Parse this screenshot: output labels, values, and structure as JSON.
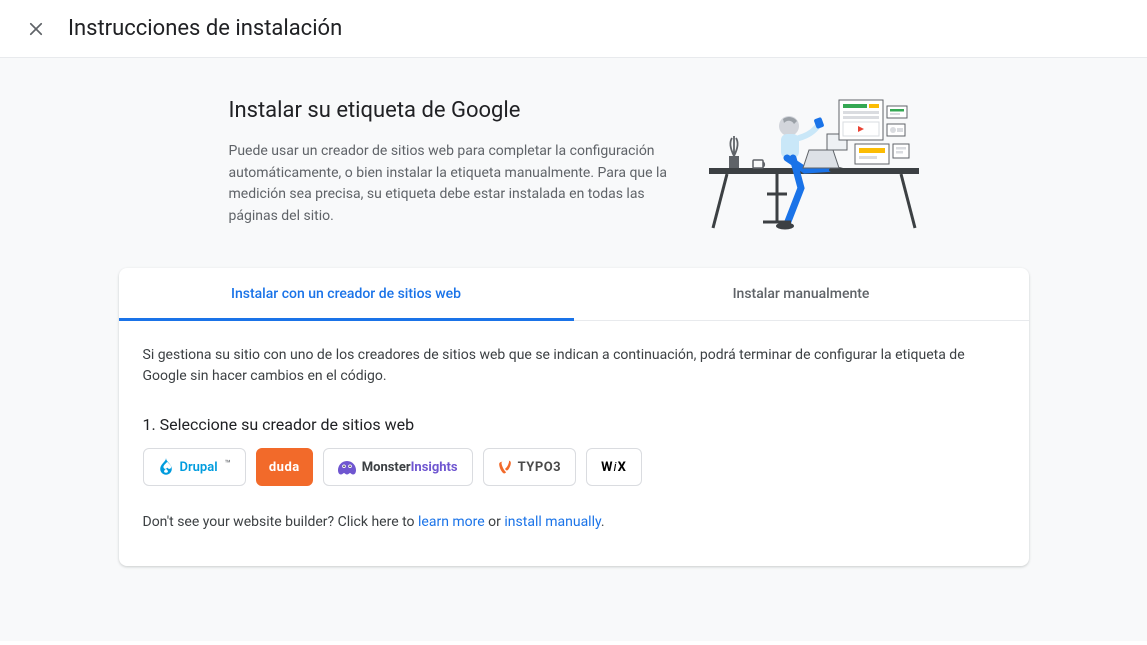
{
  "header": {
    "title": "Instrucciones de instalación"
  },
  "intro": {
    "title": "Instalar su etiqueta de Google",
    "description": "Puede usar un creador de sitios web para completar la configuración automáticamente, o bien instalar la etiqueta manualmente. Para que la medición sea precisa, su etiqueta debe estar instalada en todas las páginas del sitio."
  },
  "tabs": [
    {
      "id": "builder",
      "label": "Instalar con un creador de sitios web",
      "active": true
    },
    {
      "id": "manual",
      "label": "Instalar manualmente",
      "active": false
    }
  ],
  "builder_tab": {
    "description": "Si gestiona su sitio con uno de los creadores de sitios web que se indican a continuación, podrá terminar de configurar la etiqueta de Google sin hacer cambios en el código.",
    "step_title": "1. Seleccione su creador de sitios web",
    "builders": [
      {
        "id": "drupal",
        "label": "Drupal"
      },
      {
        "id": "duda",
        "label": "duda"
      },
      {
        "id": "monsterinsights",
        "label_part1": "Monster",
        "label_part2": "Insights"
      },
      {
        "id": "typo3",
        "label": "TYPO3"
      },
      {
        "id": "wix",
        "label": "WiX"
      }
    ],
    "help": {
      "prefix": "Don't see your website builder? Click here to ",
      "learn_more": "learn more",
      "middle": " or ",
      "install_manually": "install manually",
      "suffix": "."
    }
  }
}
